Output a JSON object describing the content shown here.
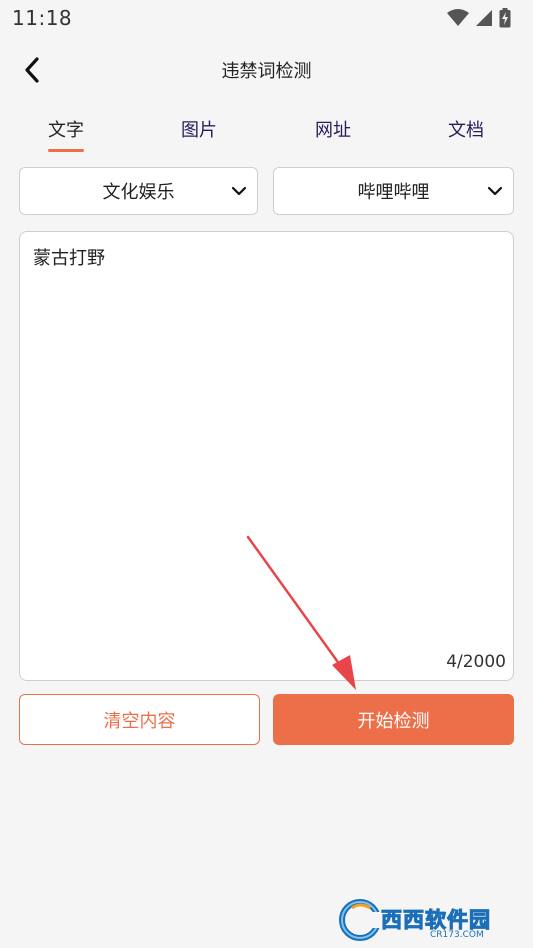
{
  "status_bar": {
    "time": "11:18",
    "icons": [
      "wifi-icon",
      "signal-icon",
      "battery-charging-icon"
    ]
  },
  "app_bar": {
    "back_icon": "chevron-left-icon",
    "title": "违禁词检测"
  },
  "tabs": [
    {
      "label": "文字",
      "active": true
    },
    {
      "label": "图片",
      "active": false
    },
    {
      "label": "网址",
      "active": false
    },
    {
      "label": "文档",
      "active": false
    }
  ],
  "selects": {
    "category": {
      "value": "文化娱乐",
      "icon": "chevron-down-icon"
    },
    "platform": {
      "value": "哔哩哔哩",
      "icon": "chevron-down-icon"
    }
  },
  "editor": {
    "value": "蒙古打野",
    "char_count": "4/2000"
  },
  "actions": {
    "clear_label": "清空内容",
    "start_label": "开始检测"
  },
  "watermark": {
    "brand": "西西软件园",
    "domain": "CR173.COM"
  },
  "colors": {
    "accent": "#ec6f4a",
    "background": "#f6f5f5",
    "tab_text": "#2b1a5a",
    "annotation_arrow": "#e8454a"
  }
}
